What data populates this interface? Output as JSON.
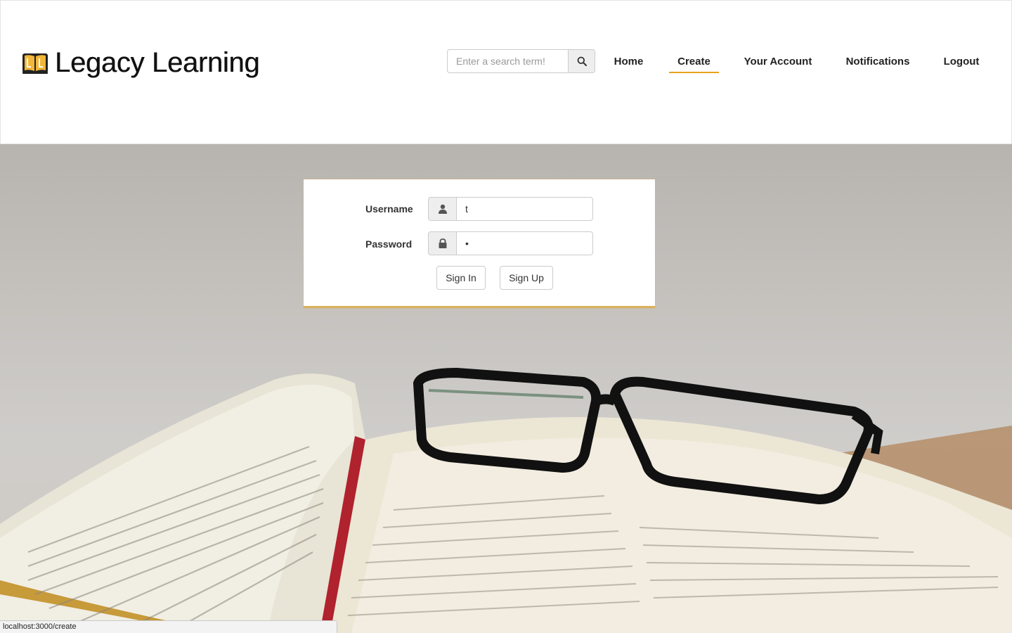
{
  "header": {
    "brand_title": "Legacy Learning",
    "search": {
      "placeholder": "Enter a search term!"
    },
    "nav": [
      {
        "label": "Home",
        "active": false
      },
      {
        "label": "Create",
        "active": true
      },
      {
        "label": "Your Account",
        "active": false
      },
      {
        "label": "Notifications",
        "active": false
      },
      {
        "label": "Logout",
        "active": false
      }
    ]
  },
  "login": {
    "username_label": "Username",
    "username_value": "t",
    "password_label": "Password",
    "password_value": "•",
    "sign_in_label": "Sign In",
    "sign_up_label": "Sign Up"
  },
  "status_bar": {
    "url": "localhost:3000/create"
  },
  "colors": {
    "accent": "#e8a21a",
    "card_border": "#d8b260"
  },
  "icons": {
    "brand": "open-book-icon",
    "search": "search-icon",
    "username": "user-icon",
    "password": "lock-icon"
  }
}
